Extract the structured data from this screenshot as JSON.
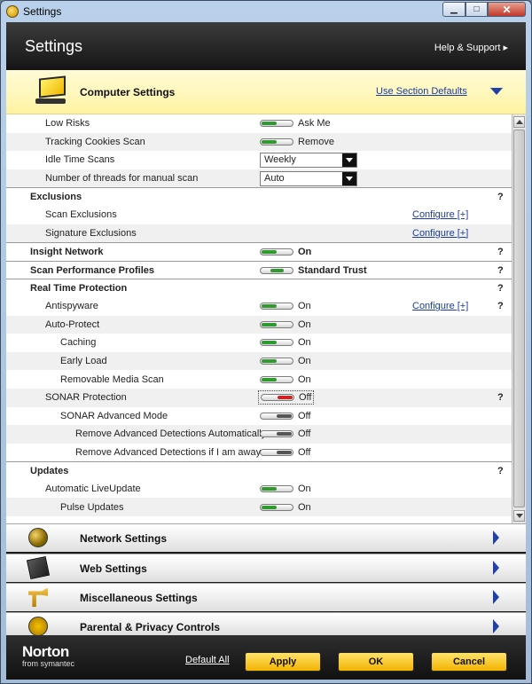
{
  "window": {
    "title": "Settings",
    "icon": "norton-icon"
  },
  "header": {
    "title": "Settings",
    "help": "Help & Support"
  },
  "section": {
    "title": "Computer Settings",
    "defaults_link": "Use Section Defaults"
  },
  "rows": [
    {
      "type": "item",
      "level": 1,
      "label": "Low Risks",
      "control": "toggle",
      "state": "on",
      "value": "Ask Me"
    },
    {
      "type": "item",
      "level": 1,
      "label": "Tracking Cookies Scan",
      "control": "toggle",
      "state": "on",
      "value": "Remove"
    },
    {
      "type": "item",
      "level": 1,
      "label": "Idle Time Scans",
      "control": "select",
      "value": "Weekly"
    },
    {
      "type": "item",
      "level": 1,
      "label": "Number of threads for manual scan",
      "control": "select",
      "value": "Auto"
    },
    {
      "type": "group",
      "label": "Exclusions",
      "help": "?"
    },
    {
      "type": "item",
      "level": 1,
      "label": "Scan Exclusions",
      "configure": "Configure [+]"
    },
    {
      "type": "item",
      "level": 1,
      "label": "Signature Exclusions",
      "configure": "Configure [+]"
    },
    {
      "type": "group",
      "label": "Insight Network",
      "control": "toggle",
      "state": "on",
      "value": "On",
      "help": "?"
    },
    {
      "type": "group",
      "label": "Scan Performance Profiles",
      "control": "toggle",
      "state": "mid",
      "value": "Standard Trust",
      "help": "?"
    },
    {
      "type": "group",
      "label": "Real Time Protection",
      "help": "?"
    },
    {
      "type": "item",
      "level": 1,
      "label": "Antispyware",
      "control": "toggle",
      "state": "on",
      "value": "On",
      "configure": "Configure [+]",
      "help": "?"
    },
    {
      "type": "item",
      "level": 1,
      "label": "Auto-Protect",
      "control": "toggle",
      "state": "on",
      "value": "On"
    },
    {
      "type": "item",
      "level": 2,
      "label": "Caching",
      "control": "toggle",
      "state": "on",
      "value": "On"
    },
    {
      "type": "item",
      "level": 2,
      "label": "Early Load",
      "control": "toggle",
      "state": "on",
      "value": "On"
    },
    {
      "type": "item",
      "level": 2,
      "label": "Removable Media Scan",
      "control": "toggle",
      "state": "on",
      "value": "On"
    },
    {
      "type": "item",
      "level": 1,
      "label": "SONAR Protection",
      "control": "toggle",
      "state": "red",
      "value": "Off",
      "focused": true,
      "help": "?"
    },
    {
      "type": "item",
      "level": 2,
      "label": "SONAR Advanced Mode",
      "control": "toggle",
      "state": "off",
      "value": "Off"
    },
    {
      "type": "item",
      "level": 3,
      "label": "Remove Advanced Detections Automatically",
      "control": "toggle",
      "state": "off",
      "value": "Off"
    },
    {
      "type": "item",
      "level": 3,
      "label": "Remove Advanced Detections if I am away",
      "control": "toggle",
      "state": "off",
      "value": "Off"
    },
    {
      "type": "group",
      "label": "Updates",
      "help": "?"
    },
    {
      "type": "item",
      "level": 1,
      "label": "Automatic LiveUpdate",
      "control": "toggle",
      "state": "on",
      "value": "On"
    },
    {
      "type": "item",
      "level": 2,
      "label": "Pulse Updates",
      "control": "toggle",
      "state": "on",
      "value": "On"
    }
  ],
  "categories": [
    {
      "label": "Network Settings",
      "icon": "globe-icon"
    },
    {
      "label": "Web Settings",
      "icon": "web-icon"
    },
    {
      "label": "Miscellaneous Settings",
      "icon": "drill-icon"
    },
    {
      "label": "Parental & Privacy Controls",
      "icon": "family-icon"
    }
  ],
  "footer": {
    "logo": "Norton",
    "logo_sub": "from symantec",
    "default_all": "Default All",
    "apply": "Apply",
    "ok": "OK",
    "cancel": "Cancel"
  },
  "colors": {
    "accent_yellow": "#f5b800",
    "link_blue": "#1b3ca0",
    "toggle_on": "#2f9a2f",
    "toggle_off_red": "#d02222"
  }
}
